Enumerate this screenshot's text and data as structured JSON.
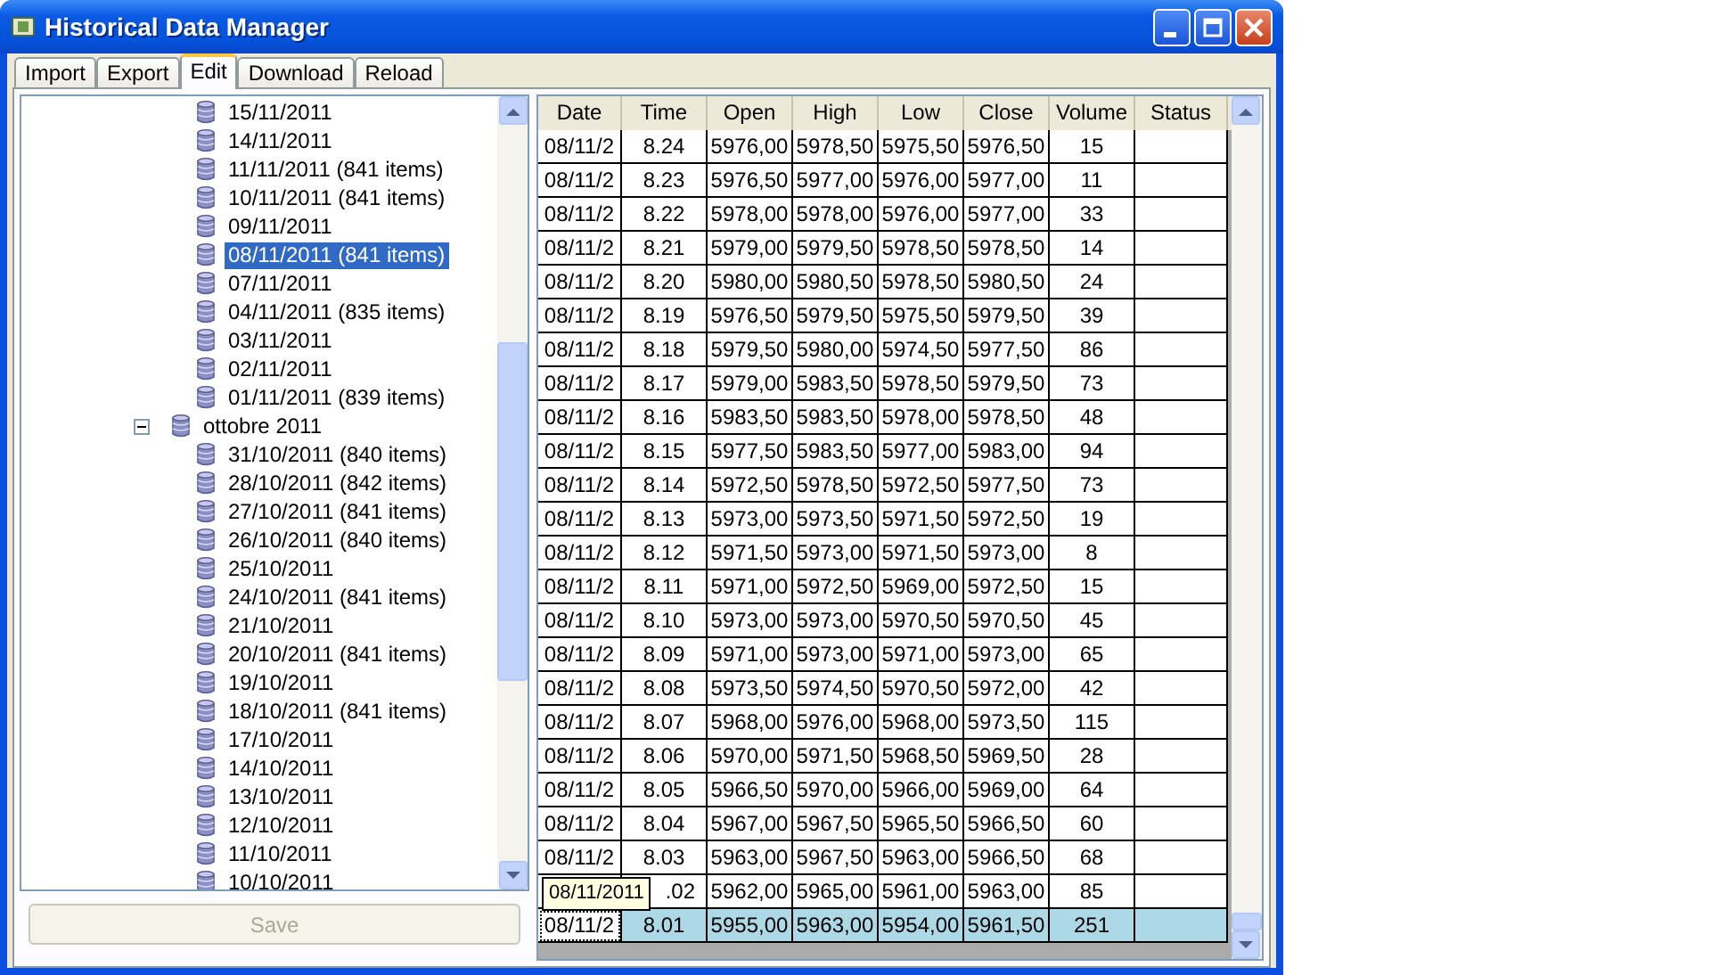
{
  "window": {
    "title": "Historical Data Manager"
  },
  "tabs": [
    {
      "label": "Import",
      "selected": false
    },
    {
      "label": "Export",
      "selected": false
    },
    {
      "label": "Edit",
      "selected": true
    },
    {
      "label": "Download",
      "selected": false
    },
    {
      "label": "Reload",
      "selected": false
    }
  ],
  "tree": {
    "nodes": [
      {
        "children": [
          {
            "label": "15/11/2011",
            "selected": false
          },
          {
            "label": "14/11/2011",
            "selected": false
          },
          {
            "label": "11/11/2011 (841 items)",
            "selected": false
          },
          {
            "label": "10/11/2011 (841 items)",
            "selected": false
          },
          {
            "label": "09/11/2011",
            "selected": false
          },
          {
            "label": "08/11/2011 (841 items)",
            "selected": true
          },
          {
            "label": "07/11/2011",
            "selected": false
          },
          {
            "label": "04/11/2011 (835 items)",
            "selected": false
          },
          {
            "label": "03/11/2011",
            "selected": false
          },
          {
            "label": "02/11/2011",
            "selected": false
          },
          {
            "label": "01/11/2011 (839 items)",
            "selected": false
          }
        ]
      },
      {
        "label": "ottobre 2011",
        "expanded": true,
        "selected": false,
        "children": [
          {
            "label": "31/10/2011 (840 items)",
            "selected": false
          },
          {
            "label": "28/10/2011 (842 items)",
            "selected": false
          },
          {
            "label": "27/10/2011 (841 items)",
            "selected": false
          },
          {
            "label": "26/10/2011 (840 items)",
            "selected": false
          },
          {
            "label": "25/10/2011",
            "selected": false
          },
          {
            "label": "24/10/2011 (841 items)",
            "selected": false
          },
          {
            "label": "21/10/2011",
            "selected": false
          },
          {
            "label": "20/10/2011 (841 items)",
            "selected": false
          },
          {
            "label": "19/10/2011",
            "selected": false
          },
          {
            "label": "18/10/2011 (841 items)",
            "selected": false
          },
          {
            "label": "17/10/2011",
            "selected": false
          },
          {
            "label": "14/10/2011",
            "selected": false
          },
          {
            "label": "13/10/2011",
            "selected": false
          },
          {
            "label": "12/10/2011",
            "selected": false
          },
          {
            "label": "11/10/2011",
            "selected": false
          },
          {
            "label": "10/10/2011",
            "selected": false
          }
        ]
      }
    ]
  },
  "save_button": {
    "label": "Save",
    "disabled": true
  },
  "table": {
    "columns": [
      "Date",
      "Time",
      "Open",
      "High",
      "Low",
      "Close",
      "Volume",
      "Status"
    ],
    "rows": [
      {
        "cells": [
          "08/11/2",
          "8.24",
          "5976,00",
          "5978,50",
          "5975,50",
          "5976,50",
          "15"
        ],
        "selected": false
      },
      {
        "cells": [
          "08/11/2",
          "8.23",
          "5976,50",
          "5977,00",
          "5976,00",
          "5977,00",
          "11"
        ],
        "selected": false
      },
      {
        "cells": [
          "08/11/2",
          "8.22",
          "5978,00",
          "5978,00",
          "5976,00",
          "5977,00",
          "33"
        ],
        "selected": false
      },
      {
        "cells": [
          "08/11/2",
          "8.21",
          "5979,00",
          "5979,50",
          "5978,50",
          "5978,50",
          "14"
        ],
        "selected": false
      },
      {
        "cells": [
          "08/11/2",
          "8.20",
          "5980,00",
          "5980,50",
          "5978,50",
          "5980,50",
          "24"
        ],
        "selected": false
      },
      {
        "cells": [
          "08/11/2",
          "8.19",
          "5976,50",
          "5979,50",
          "5975,50",
          "5979,50",
          "39"
        ],
        "selected": false
      },
      {
        "cells": [
          "08/11/2",
          "8.18",
          "5979,50",
          "5980,00",
          "5974,50",
          "5977,50",
          "86"
        ],
        "selected": false
      },
      {
        "cells": [
          "08/11/2",
          "8.17",
          "5979,00",
          "5983,50",
          "5978,50",
          "5979,50",
          "73"
        ],
        "selected": false
      },
      {
        "cells": [
          "08/11/2",
          "8.16",
          "5983,50",
          "5983,50",
          "5978,00",
          "5978,50",
          "48"
        ],
        "selected": false
      },
      {
        "cells": [
          "08/11/2",
          "8.15",
          "5977,50",
          "5983,50",
          "5977,00",
          "5983,00",
          "94"
        ],
        "selected": false
      },
      {
        "cells": [
          "08/11/2",
          "8.14",
          "5972,50",
          "5978,50",
          "5972,50",
          "5977,50",
          "73"
        ],
        "selected": false
      },
      {
        "cells": [
          "08/11/2",
          "8.13",
          "5973,00",
          "5973,50",
          "5971,50",
          "5972,50",
          "19"
        ],
        "selected": false
      },
      {
        "cells": [
          "08/11/2",
          "8.12",
          "5971,50",
          "5973,00",
          "5971,50",
          "5973,00",
          "8"
        ],
        "selected": false
      },
      {
        "cells": [
          "08/11/2",
          "8.11",
          "5971,00",
          "5972,50",
          "5969,00",
          "5972,50",
          "15"
        ],
        "selected": false
      },
      {
        "cells": [
          "08/11/2",
          "8.10",
          "5973,00",
          "5973,00",
          "5970,50",
          "5970,50",
          "45"
        ],
        "selected": false
      },
      {
        "cells": [
          "08/11/2",
          "8.09",
          "5971,00",
          "5973,00",
          "5971,00",
          "5973,00",
          "65"
        ],
        "selected": false
      },
      {
        "cells": [
          "08/11/2",
          "8.08",
          "5973,50",
          "5974,50",
          "5970,50",
          "5972,00",
          "42"
        ],
        "selected": false
      },
      {
        "cells": [
          "08/11/2",
          "8.07",
          "5968,00",
          "5976,00",
          "5968,00",
          "5973,50",
          "115"
        ],
        "selected": false
      },
      {
        "cells": [
          "08/11/2",
          "8.06",
          "5970,00",
          "5971,50",
          "5968,50",
          "5969,50",
          "28"
        ],
        "selected": false
      },
      {
        "cells": [
          "08/11/2",
          "8.05",
          "5966,50",
          "5970,00",
          "5966,00",
          "5969,00",
          "64"
        ],
        "selected": false
      },
      {
        "cells": [
          "08/11/2",
          "8.04",
          "5967,00",
          "5967,50",
          "5965,50",
          "5966,50",
          "60"
        ],
        "selected": false
      },
      {
        "cells": [
          "08/11/2",
          "8.03",
          "5963,00",
          "5967,50",
          "5963,00",
          "5966,50",
          "68"
        ],
        "selected": false
      },
      {
        "cells": [
          null,
          ".02",
          "5962,00",
          "5965,00",
          "5961,00",
          "5963,00",
          "85"
        ],
        "selected": false,
        "tooltip": "08/11/2011"
      },
      {
        "cells": [
          "08/11/2",
          "8.01",
          "5955,00",
          "5963,00",
          "5954,00",
          "5961,50",
          "251"
        ],
        "selected": true
      }
    ]
  }
}
